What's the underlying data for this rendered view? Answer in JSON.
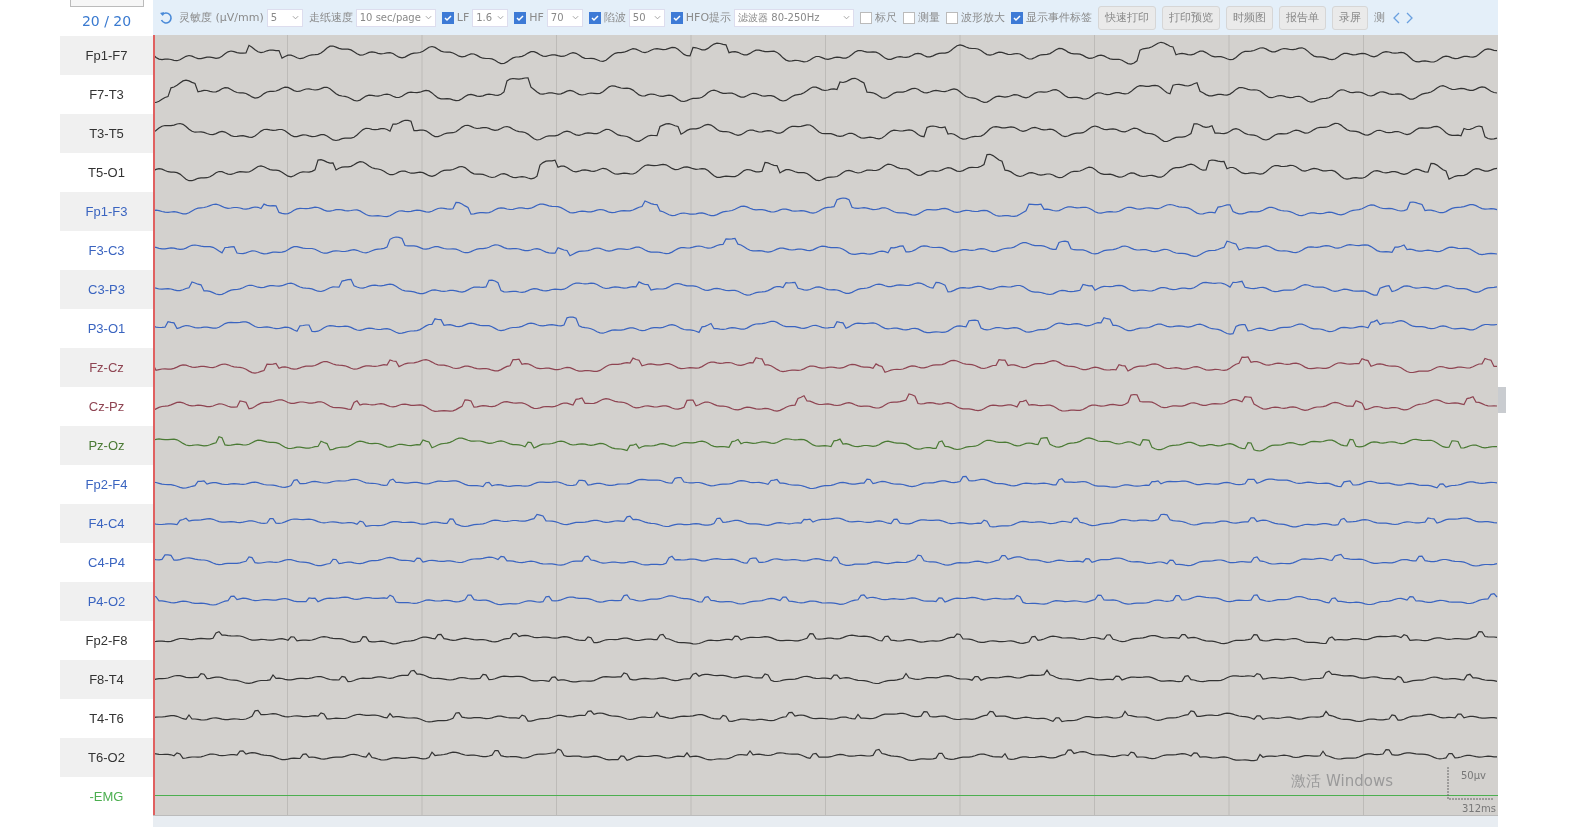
{
  "page_counter": "20 / 20",
  "toolbar": [
    {
      "kind": "select",
      "label": "灵敏度 (μV/mm)",
      "value": "5"
    },
    {
      "kind": "select",
      "label": "走纸速度",
      "value": "10 sec/page"
    },
    {
      "kind": "check-select",
      "label": "LF",
      "checked": true,
      "value": "1.6"
    },
    {
      "kind": "check-select",
      "label": "HF",
      "checked": true,
      "value": "70"
    },
    {
      "kind": "check-select",
      "label": "陷波",
      "checked": true,
      "value": "50"
    },
    {
      "kind": "check-select",
      "label": "HFO提示",
      "checked": true,
      "value": "滤波器 80-250Hz",
      "wide": true
    },
    {
      "kind": "check",
      "label": "标尺",
      "checked": false
    },
    {
      "kind": "check",
      "label": "测量",
      "checked": false
    },
    {
      "kind": "check",
      "label": "波形放大",
      "checked": false
    },
    {
      "kind": "check",
      "label": "显示事件标签",
      "checked": true
    },
    {
      "kind": "button",
      "label": "快速打印"
    },
    {
      "kind": "button",
      "label": "打印预览"
    },
    {
      "kind": "button",
      "label": "时频图"
    },
    {
      "kind": "button",
      "label": "报告单"
    },
    {
      "kind": "button",
      "label": "录屏"
    },
    {
      "kind": "text",
      "label": "测"
    }
  ],
  "channels": [
    {
      "name": "Fp1-F7",
      "color": "#333333",
      "kind": "wave"
    },
    {
      "name": "F7-T3",
      "color": "#333333",
      "kind": "wave"
    },
    {
      "name": "T3-T5",
      "color": "#333333",
      "kind": "wave"
    },
    {
      "name": "T5-O1",
      "color": "#333333",
      "kind": "wave"
    },
    {
      "name": "Fp1-F3",
      "color": "#3a64c0",
      "kind": "wave"
    },
    {
      "name": "F3-C3",
      "color": "#3a64c0",
      "kind": "wave"
    },
    {
      "name": "C3-P3",
      "color": "#3a64c0",
      "kind": "wave"
    },
    {
      "name": "P3-O1",
      "color": "#3a64c0",
      "kind": "wave"
    },
    {
      "name": "Fz-Cz",
      "color": "#8e4452",
      "kind": "wave"
    },
    {
      "name": "Cz-Pz",
      "color": "#8e4452",
      "kind": "wave"
    },
    {
      "name": "Pz-Oz",
      "color": "#4a7a34",
      "kind": "wave"
    },
    {
      "name": "Fp2-F4",
      "color": "#3a64c0",
      "kind": "wave"
    },
    {
      "name": "F4-C4",
      "color": "#3a64c0",
      "kind": "wave"
    },
    {
      "name": "C4-P4",
      "color": "#3a64c0",
      "kind": "wave"
    },
    {
      "name": "P4-O2",
      "color": "#3a64c0",
      "kind": "wave"
    },
    {
      "name": "Fp2-F8",
      "color": "#333333",
      "kind": "wave"
    },
    {
      "name": "F8-T4",
      "color": "#333333",
      "kind": "wave"
    },
    {
      "name": "T4-T6",
      "color": "#333333",
      "kind": "wave"
    },
    {
      "name": "T6-O2",
      "color": "#333333",
      "kind": "wave"
    },
    {
      "name": "-EMG",
      "color": "#4caf50",
      "kind": "flat"
    }
  ],
  "scale": {
    "amplitude": "50μv",
    "time": "312ms"
  },
  "os_notice": "激活 Windows"
}
